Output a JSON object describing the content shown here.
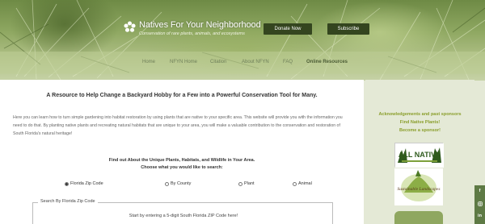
{
  "header": {
    "site_title": "Natives For Your Neighborhood",
    "tagline": "Conservation of rare plants, animals, and ecosystems",
    "donate_label": "Donate Now",
    "subscribe_label": "Subscribe"
  },
  "nav": {
    "items": [
      {
        "label": "Home"
      },
      {
        "label": "NFYN Home"
      },
      {
        "label": "Citation"
      },
      {
        "label": "About NFYN"
      },
      {
        "label": "FAQ"
      },
      {
        "label": "Online Resources"
      }
    ],
    "active_index": 5
  },
  "main": {
    "title": "A Resource to Help Change a Backyard Hobby for a Few into a Powerful Conservation Tool for Many.",
    "paragraph": "Here you can learn how to turn simple gardening into habitat restoration by using plants that are native to your specific area. This website will provide you with the information you need to do that. By planting native plants and recreating natural habitats that are unique to your area, you will make a valuable contribution to the conservation and restoration of South Florida's natural heritage!",
    "find_line1": "Find out About the Unique Plants, Habitats, and Wildlife in Your Area.",
    "find_line2": "Choose what you would like to search:",
    "search_options": [
      {
        "label": "Florida Zip Code",
        "selected": true
      },
      {
        "label": "By County",
        "selected": false
      },
      {
        "label": "Plant",
        "selected": false
      },
      {
        "label": "Animal",
        "selected": false
      }
    ],
    "zip_legend": "Search By Florida Zip Code",
    "zip_instruction": "Start by entering a 5-digit South Florida ZIP Code here!"
  },
  "sidebar": {
    "ack_label": "Acknowledgements and past sponsors",
    "find_plants_label": "Find Native Plants!",
    "become_sponsor_label": "Become a sponsor!",
    "sponsor1_text": "ALL NATIVE",
    "sponsor2_text": "Sustainable Landscapes"
  },
  "social": {
    "icons": [
      "facebook-icon",
      "instagram-icon",
      "linkedin-icon"
    ]
  },
  "colors": {
    "accent_green": "#8a9e2b",
    "button_dark": "#34451f",
    "sidebar_bg": "#e4e9d6"
  }
}
